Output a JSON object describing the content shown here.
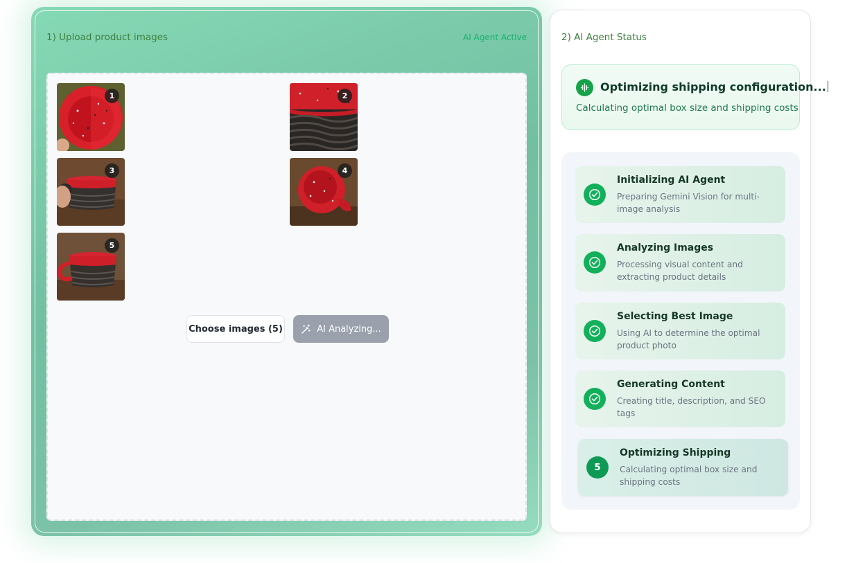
{
  "upload": {
    "title": "1) Upload product images",
    "agent_status": "AI Agent Active",
    "images": [
      {
        "number": "1"
      },
      {
        "number": "2"
      },
      {
        "number": "3"
      },
      {
        "number": "4"
      },
      {
        "number": "5"
      }
    ],
    "choose_button": "Choose images (5)",
    "analyzing_button": "AI Analyzing..."
  },
  "status": {
    "title": "2) AI Agent Status",
    "current": {
      "title": "Optimizing shipping configuration...",
      "description": "Calculating optimal box size and shipping costs"
    },
    "steps": [
      {
        "title": "Initializing AI Agent",
        "description": "Preparing Gemini Vision for multi-image analysis",
        "state": "done"
      },
      {
        "title": "Analyzing Images",
        "description": "Processing visual content and extracting product details",
        "state": "done"
      },
      {
        "title": "Selecting Best Image",
        "description": "Using AI to determine the optimal product photo",
        "state": "done"
      },
      {
        "title": "Generating Content",
        "description": "Creating title, description, and SEO tags",
        "state": "done"
      },
      {
        "title": "Optimizing Shipping",
        "description": "Calculating optimal box size and shipping costs",
        "state": "active",
        "number": "5"
      }
    ]
  },
  "colors": {
    "accent_green": "#12b05a",
    "agent_active": "#17b26a",
    "button_disabled": "#9aa1ad"
  }
}
